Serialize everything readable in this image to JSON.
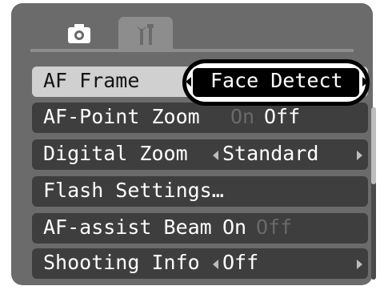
{
  "tabs": [
    {
      "icon": "camera-icon",
      "active": true
    },
    {
      "icon": "tools-icon",
      "active": false
    }
  ],
  "menu": {
    "items": [
      {
        "label": "AF Frame",
        "value": "Face Detect",
        "selected": true
      },
      {
        "label": "AF-Point Zoom",
        "value_on": "On",
        "value_off": "Off",
        "current": "Off"
      },
      {
        "label": "Digital Zoom",
        "value": "Standard"
      },
      {
        "label": "Flash Settings…"
      },
      {
        "label": "AF-assist Beam",
        "value_on": "On",
        "value_off": "Off",
        "current": "On"
      },
      {
        "label": "Shooting Info",
        "value": "Off"
      }
    ]
  },
  "colors": {
    "screen_bg": "#6b6b6b",
    "row_bg": "#3e3e3e",
    "selected_row_bg": "#d0d0d0",
    "text": "#ffffff"
  }
}
